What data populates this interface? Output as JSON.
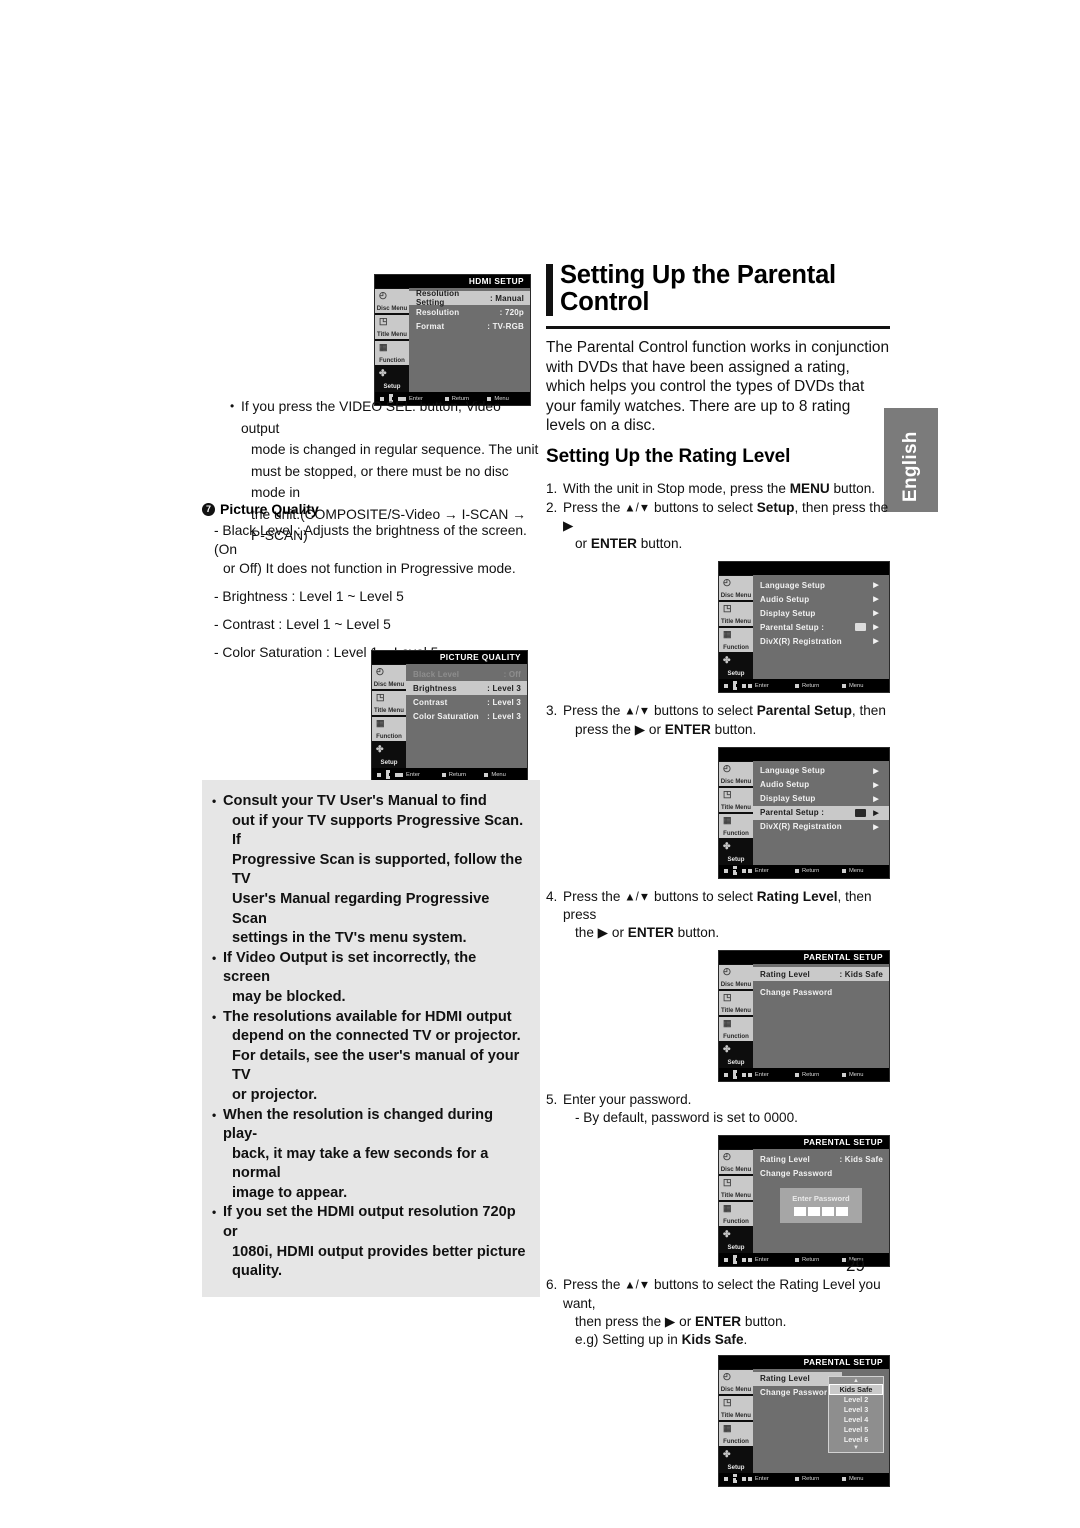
{
  "page": {
    "number": "29",
    "side_tab": "English"
  },
  "left_column": {
    "bullet_video_sel": {
      "lines": [
        "• If you press the VIDEO SEL. button, Video output",
        "mode is changed in regular sequence. The unit",
        "must be stopped, or there must be no disc mode in",
        "the unit.(COMPOSITE/S-Video → I-SCAN → P-SCAN)"
      ]
    },
    "picture_quality": {
      "marker": "7",
      "heading": "Picture Quality",
      "items": [
        [
          "- Black Level : Adjusts the brightness of the screen.(On",
          "or Off) It does not function in Progressive mode."
        ],
        [
          "- Brightness : Level 1 ~ Level 5"
        ],
        [
          "- Contrast : Level 1 ~ Level 5"
        ],
        [
          "- Color Saturation : Level 1 ~ Level 5"
        ]
      ]
    },
    "note_box": {
      "bullets": [
        [
          "Consult your TV User's Manual to find",
          "out if your TV supports Progressive Scan. If",
          "Progressive Scan is supported, follow the TV",
          "User's Manual regarding Progressive Scan",
          "settings in the TV's menu system."
        ],
        [
          "If Video Output is set incorrectly, the screen",
          "may be blocked."
        ],
        [
          "The resolutions available for HDMI output",
          "depend on the connected TV or projector.",
          "For details, see the user's manual of your TV",
          "or projector."
        ],
        [
          "When the resolution is changed during play-",
          "back, it may take a few seconds for a normal",
          "image to appear."
        ],
        [
          "If you set the HDMI output resolution 720p or",
          "1080i, HDMI output provides better picture",
          "quality."
        ]
      ]
    }
  },
  "right_column": {
    "title_line1": "Setting Up the Parental",
    "title_line2": "Control",
    "intro": "The Parental Control function works in conjunction with DVDs that have been assigned a rating, which helps you control the types of DVDs that your family watches. There are up to 8 rating levels on a disc.",
    "subheading": "Setting Up the Rating Level",
    "steps": [
      {
        "num": "1.",
        "line1": "With the unit in Stop mode, press the MENU button.",
        "line1_pre": "With the unit in Stop mode, press the ",
        "bold1": "MENU",
        "line1_post": " button.",
        "cont": ""
      },
      {
        "num": "2.",
        "pre": "Press the ",
        "updn": "▲/▼",
        "mid": " buttons to select ",
        "bold": "Setup",
        "post": ", then press the ▶",
        "cont_pre": "or ",
        "cont_bold": "ENTER",
        "cont_post": " button."
      },
      {
        "num": "3.",
        "pre": "Press the ",
        "updn": "▲/▼",
        "mid": " buttons to select ",
        "bold": "Parental Setup",
        "post": ", then",
        "cont_pre": "press the ▶ or ",
        "cont_bold": "ENTER",
        "cont_post": " button."
      },
      {
        "num": "4.",
        "pre": "Press the ",
        "updn": "▲/▼",
        "mid": " buttons to select ",
        "bold": "Rating Level",
        "post": ", then press",
        "cont_pre": "the ▶ or ",
        "cont_bold": "ENTER",
        "cont_post": " button."
      },
      {
        "num": "5.",
        "line": "Enter your password.",
        "dash": "- By default, password is set to 0000."
      },
      {
        "num": "6.",
        "pre": "Press the ",
        "updn": "▲/▼",
        "mid": " buttons to select the Rating Level you want,",
        "cont_pre": "then press the ▶ or ",
        "cont_bold": "ENTER",
        "cont_post": " button.",
        "eg_pre": "e.g) Setting up in ",
        "eg_bold": "Kids Safe",
        "eg_post": "."
      }
    ]
  },
  "osd_footer": {
    "enter": "Enter",
    "return": "Return",
    "menu": "Menu"
  },
  "osd_sidebar": [
    {
      "label": "Disc Menu",
      "icon": "disc-menu-icon"
    },
    {
      "label": "Title Menu",
      "icon": "title-menu-icon"
    },
    {
      "label": "Function",
      "icon": "function-icon"
    },
    {
      "label": "Setup",
      "icon": "gear-icon"
    }
  ],
  "osd_hdmi_setup": {
    "title": "HDMI SETUP",
    "rows": [
      {
        "label": "Resolution Setting",
        "value": ": Manual",
        "selected": true
      },
      {
        "label": "Resolution",
        "value": ": 720p",
        "selected": false
      },
      {
        "label": "Format",
        "value": ": TV-RGB",
        "selected": false
      }
    ]
  },
  "osd_picture_quality": {
    "title": "PICTURE QUALITY",
    "rows": [
      {
        "label": "Black Level",
        "value": ": Off",
        "selected": false,
        "dim": true
      },
      {
        "label": "Brightness",
        "value": ": Level 3",
        "selected": true,
        "dim": false
      },
      {
        "label": "Contrast",
        "value": ": Level 3",
        "selected": false,
        "dim": false
      },
      {
        "label": "Color Saturation",
        "value": ": Level 3",
        "selected": false,
        "dim": false
      }
    ]
  },
  "osd_setup_menu_1": {
    "title": "",
    "rows": [
      {
        "label": "Language Setup",
        "value": "",
        "chev": "▶",
        "selected": false
      },
      {
        "label": "Audio Setup",
        "value": "",
        "chev": "▶",
        "selected": false
      },
      {
        "label": "Display Setup",
        "value": "",
        "chev": "▶",
        "selected": false
      },
      {
        "label": "Parental Setup :",
        "value": "lock-icon",
        "chev": "▶",
        "selected": false
      },
      {
        "label": "DivX(R) Registration",
        "value": "",
        "chev": "▶",
        "selected": false
      }
    ]
  },
  "osd_setup_menu_2": {
    "title": "",
    "rows": [
      {
        "label": "Language Setup",
        "value": "",
        "chev": "▶",
        "selected": false
      },
      {
        "label": "Audio Setup",
        "value": "",
        "chev": "▶",
        "selected": false
      },
      {
        "label": "Display Setup",
        "value": "",
        "chev": "▶",
        "selected": false
      },
      {
        "label": "Parental Setup :",
        "value": "lock-icon",
        "chev": "▶",
        "selected": true
      },
      {
        "label": "DivX(R) Registration",
        "value": "",
        "chev": "▶",
        "selected": false
      }
    ]
  },
  "osd_parental_setup": {
    "title": "PARENTAL SETUP",
    "rows": [
      {
        "label": "Rating Level",
        "value": ": Kids Safe",
        "selected": true
      },
      {
        "label": "Change Password",
        "value": "",
        "selected": false
      }
    ]
  },
  "osd_parental_password": {
    "title": "PARENTAL SETUP",
    "rows": [
      {
        "label": "Rating Level",
        "value": ": Kids Safe",
        "selected": false
      },
      {
        "label": "Change Password",
        "value": "",
        "selected": false
      }
    ],
    "password_prompt": "Enter Password",
    "password_cells": 4
  },
  "osd_rating_dropdown": {
    "title": "PARENTAL SETUP",
    "rows": [
      {
        "label": "Rating Level",
        "value": "",
        "selected": true
      },
      {
        "label": "Change Passwor",
        "value": "",
        "selected": false
      }
    ],
    "options": [
      "Kids Safe",
      "Level 2",
      "Level 3",
      "Level 4",
      "Level 5",
      "Level 6"
    ],
    "selected_option": "Kids Safe",
    "scroll_up": "▲",
    "scroll_down": "▼"
  },
  "colors": {
    "osd_panel_bg": "#6e6e6e",
    "osd_bar_bg": "#000000",
    "osd_selected_row": "#c9c9c9",
    "note_box_bg": "#e6e6e6",
    "side_tab_bg": "#7b7b7b"
  }
}
